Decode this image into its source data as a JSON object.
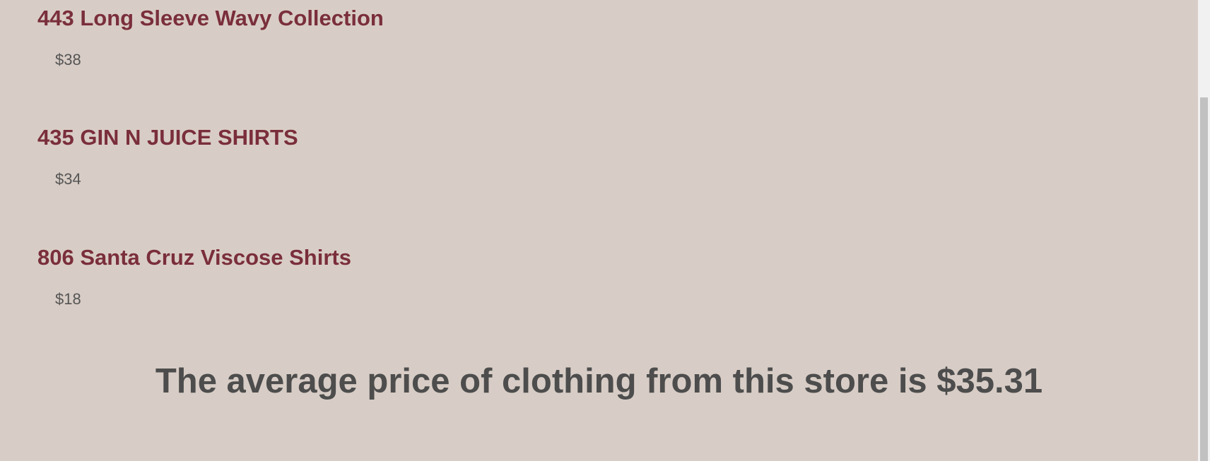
{
  "products": [
    {
      "title": "443 Long Sleeve Wavy Collection",
      "price": "$38"
    },
    {
      "title": "435 GIN N JUICE SHIRTS",
      "price": "$34"
    },
    {
      "title": "806 Santa Cruz Viscose Shirts",
      "price": "$18"
    }
  ],
  "summary": {
    "average_text": "The average price of clothing from this store is $35.31"
  },
  "colors": {
    "background": "#d8cdc6",
    "title": "#7a2e3c",
    "price": "#555555",
    "summary": "#4d4d4d",
    "scrollbar_track": "#f1f1f1",
    "scrollbar_thumb": "#c1c1c1"
  }
}
